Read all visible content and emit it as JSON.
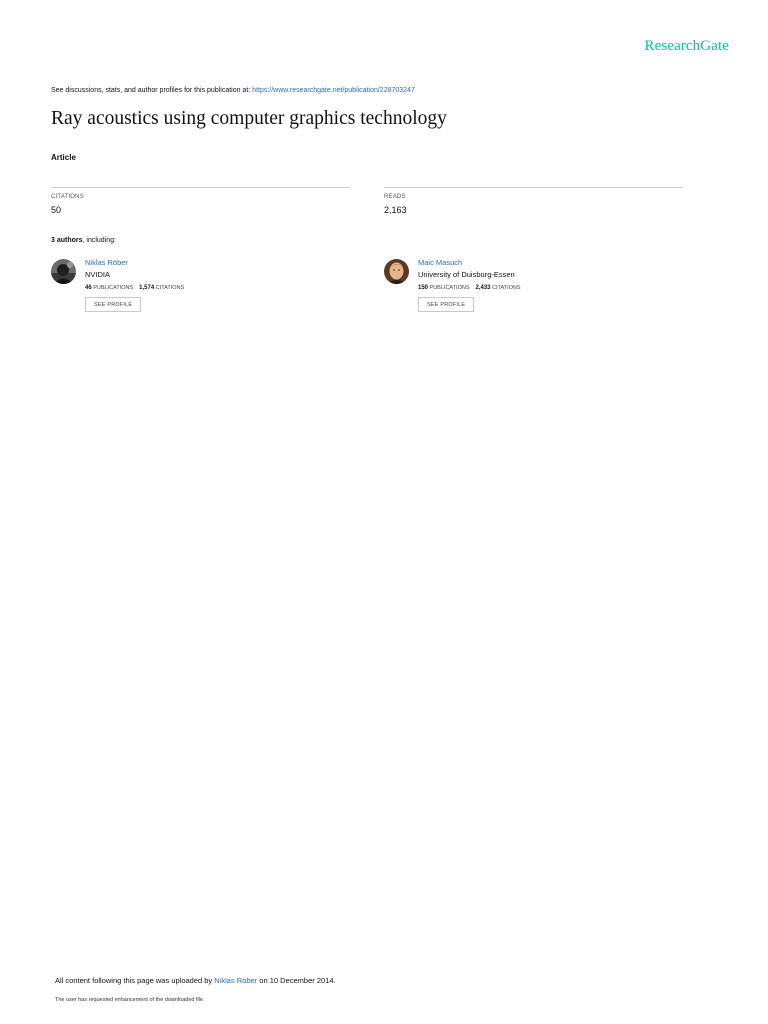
{
  "header": {
    "logo": "ResearchGate"
  },
  "discussion": {
    "prefix": "See discussions, stats, and author profiles for this publication at: ",
    "url": "https://www.researchgate.net/publication/228703247"
  },
  "publication": {
    "title": "Ray acoustics using computer graphics technology",
    "type": "Article"
  },
  "stats": {
    "citations_label": "CITATIONS",
    "citations_value": "50",
    "reads_label": "READS",
    "reads_value": "2,163"
  },
  "authors_heading": {
    "count": "3 authors",
    "suffix": ", including:"
  },
  "authors": [
    {
      "name": "Niklas Röber",
      "institution": "NVIDIA",
      "publications": "46",
      "publications_label": "PUBLICATIONS",
      "citations": "1,574",
      "citations_label": "CITATIONS",
      "button": "SEE PROFILE"
    },
    {
      "name": "Maic Masuch",
      "institution": "University of Duisburg-Essen",
      "publications": "150",
      "publications_label": "PUBLICATIONS",
      "citations": "2,433",
      "citations_label": "CITATIONS",
      "button": "SEE PROFILE"
    }
  ],
  "footer": {
    "uploaded_prefix": "All content following this page was uploaded by ",
    "uploader": "Niklas Röber",
    "uploaded_suffix": " on 10 December 2014.",
    "note": "The user has requested enhancement of the downloaded file."
  },
  "colors": {
    "brand": "#00c4a7",
    "link": "#2a6ebb"
  }
}
